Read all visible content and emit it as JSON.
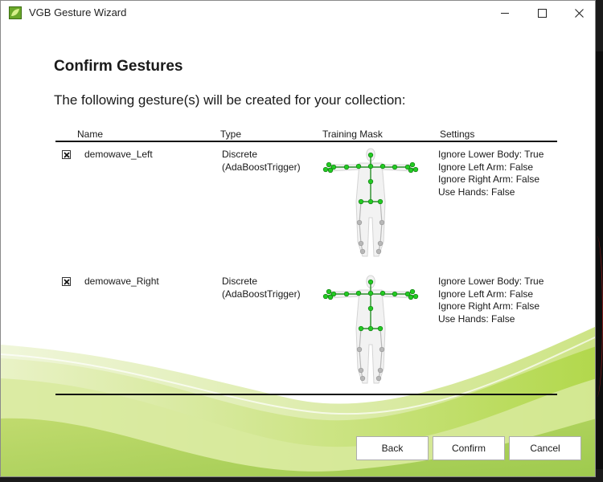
{
  "window": {
    "title": "VGB Gesture Wizard",
    "app_icon": "vgb-leaf-icon"
  },
  "page": {
    "heading": "Confirm Gestures",
    "subheading": "The following gesture(s) will be created for your collection:"
  },
  "table": {
    "columns": [
      "Name",
      "Type",
      "Training Mask",
      "Settings"
    ],
    "rows": [
      {
        "checked": true,
        "name": "demowave_Left",
        "type": "Discrete\n(AdaBoostTrigger)",
        "settings": "Ignore Lower Body: True\nIgnore Left Arm: False\nIgnore Right Arm: False\nUse Hands: False",
        "mask_icon": "skeleton-upper-body-mask"
      },
      {
        "checked": true,
        "name": "demowave_Right",
        "type": "Discrete\n(AdaBoostTrigger)",
        "settings": "Ignore Lower Body: True\nIgnore Left Arm: False\nIgnore Right Arm: False\nUse Hands: False",
        "mask_icon": "skeleton-upper-body-mask"
      }
    ]
  },
  "buttons": {
    "back": "Back",
    "confirm": "Confirm",
    "cancel": "Cancel"
  },
  "colors": {
    "mask_active": "#22cc22",
    "mask_inactive": "#b8b8b8",
    "accent_green": "#b6dc54"
  }
}
